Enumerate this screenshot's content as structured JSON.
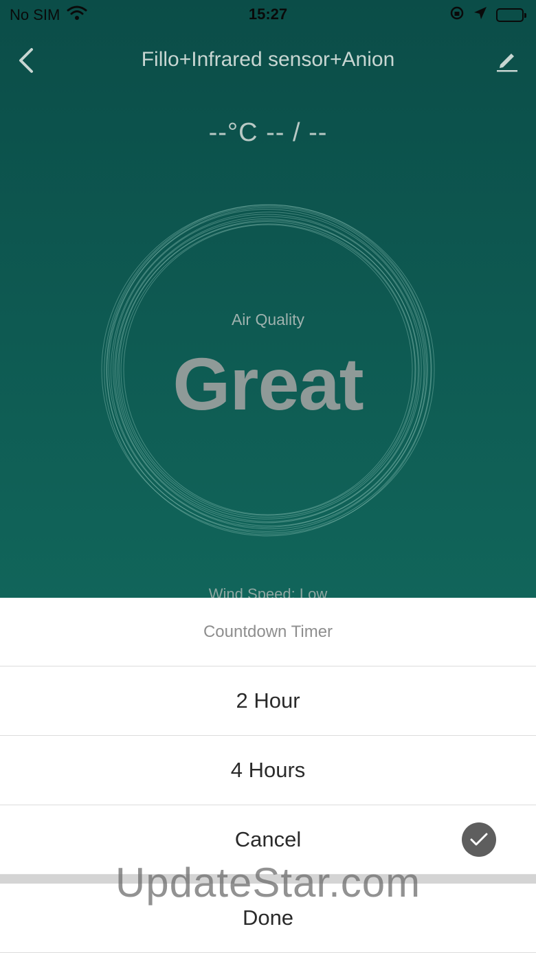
{
  "status_bar": {
    "carrier": "No SIM",
    "time": "15:27"
  },
  "nav": {
    "title": "Fillo+Infrared sensor+Anion"
  },
  "readout": {
    "temperature": "--°C -- / --"
  },
  "air_quality": {
    "label": "Air Quality",
    "value": "Great"
  },
  "wind_speed": "Wind Speed: Low",
  "countdown_sheet": {
    "title": "Countdown Timer",
    "options": [
      {
        "label": "2 Hour",
        "selected": false
      },
      {
        "label": "4 Hours",
        "selected": false
      },
      {
        "label": "Cancel",
        "selected": true
      }
    ],
    "done_label": "Done"
  },
  "watermark": "UpdateStar.com",
  "colors": {
    "background": "#0f5e54",
    "sheet": "#ffffff",
    "check_badge": "#5e5e5e"
  }
}
